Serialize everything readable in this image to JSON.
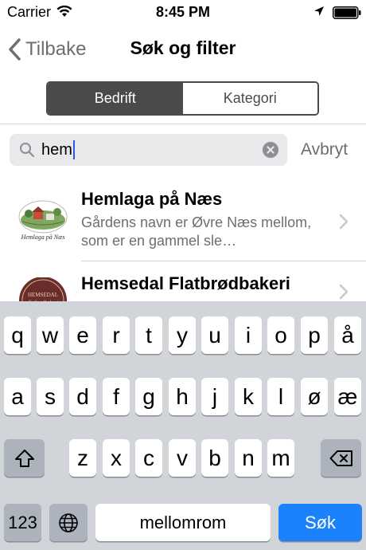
{
  "status_bar": {
    "carrier": "Carrier",
    "time": "8:45 PM"
  },
  "nav": {
    "back_label": "Tilbake",
    "title": "Søk og filter"
  },
  "segmented": {
    "options": [
      "Bedrift",
      "Kategori"
    ],
    "selected": "Bedrift"
  },
  "search": {
    "value": "hem",
    "cancel_label": "Avbryt"
  },
  "results": [
    {
      "title": "Hemlaga på Næs",
      "subtitle": "Gårdens navn er Øvre Næs mellom, som er en gammel sle…",
      "logo_text": "Hemlaga på Næs"
    },
    {
      "title": "Hemsedal Flatbrødbakeri",
      "subtitle": "",
      "logo_text": "HEMSEDAL flatbrødbakeri"
    }
  ],
  "keyboard": {
    "row1": [
      "q",
      "w",
      "e",
      "r",
      "t",
      "y",
      "u",
      "i",
      "o",
      "p",
      "å"
    ],
    "row2": [
      "a",
      "s",
      "d",
      "f",
      "g",
      "h",
      "j",
      "k",
      "l",
      "ø",
      "æ"
    ],
    "row3": [
      "z",
      "x",
      "c",
      "v",
      "b",
      "n",
      "m"
    ],
    "numbers_label": "123",
    "space_label": "mellomrom",
    "return_label": "Søk"
  },
  "colors": {
    "accent_gray": "#4a4a4a",
    "return_blue": "#1b82fb",
    "keyboard_bg": "#d1d4d9"
  }
}
